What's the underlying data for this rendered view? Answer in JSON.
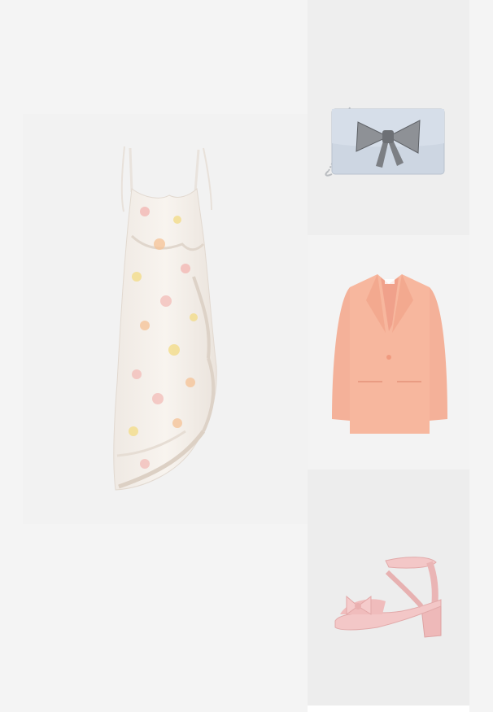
{
  "collage": {
    "items": [
      {
        "id": "dress",
        "kind": "floral ruffle maxi dress"
      },
      {
        "id": "bag",
        "kind": "satin clutch with crystal bow"
      },
      {
        "id": "blazer",
        "kind": "peach blazer"
      },
      {
        "id": "shoes",
        "kind": "pink block heel sandal"
      }
    ]
  },
  "colors": {
    "page_bg": "#f4f4f4",
    "dress_base": "#f6f1ec",
    "dress_flower_pink": "#f2b8b4",
    "dress_flower_yellow": "#f3dc8a",
    "dress_flower_peach": "#f5c49a",
    "bag": "#cdd6e2",
    "blazer": "#f7b79e",
    "shoe": "#f3c7c7"
  }
}
